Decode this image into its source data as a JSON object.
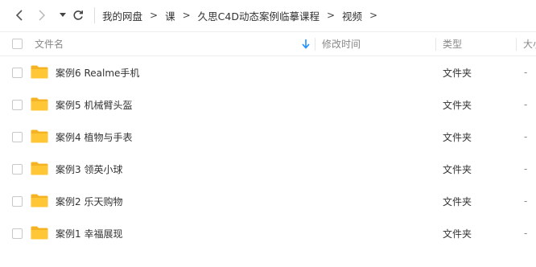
{
  "nav": {
    "back_icon": "chevron-left-icon",
    "forward_icon": "chevron-right-icon",
    "history_icon": "caret-down-icon",
    "refresh_icon": "refresh-icon",
    "breadcrumbs": [
      "我的网盘",
      "课",
      "久思C4D动态案例临摹课程",
      "视频"
    ]
  },
  "table": {
    "columns": {
      "name": "文件名",
      "modified": "修改时间",
      "type": "类型",
      "size": "大小"
    },
    "sort_icon": "arrow-down-icon",
    "rows": [
      {
        "name": "案例6 Realme手机",
        "modified": "",
        "type": "文件夹",
        "size": "-"
      },
      {
        "name": "案例5 机械臂头盔",
        "modified": "",
        "type": "文件夹",
        "size": "-"
      },
      {
        "name": "案例4 植物与手表",
        "modified": "",
        "type": "文件夹",
        "size": "-"
      },
      {
        "name": "案例3 领英小球",
        "modified": "",
        "type": "文件夹",
        "size": "-"
      },
      {
        "name": "案例2 乐天购物",
        "modified": "",
        "type": "文件夹",
        "size": "-"
      },
      {
        "name": "案例1 幸福展现",
        "modified": "",
        "type": "文件夹",
        "size": "-"
      }
    ]
  },
  "colors": {
    "folder": "#FFC636",
    "folder_back": "#F5B324",
    "sort_arrow": "#1E90FF",
    "border": "#EEEEEE"
  }
}
